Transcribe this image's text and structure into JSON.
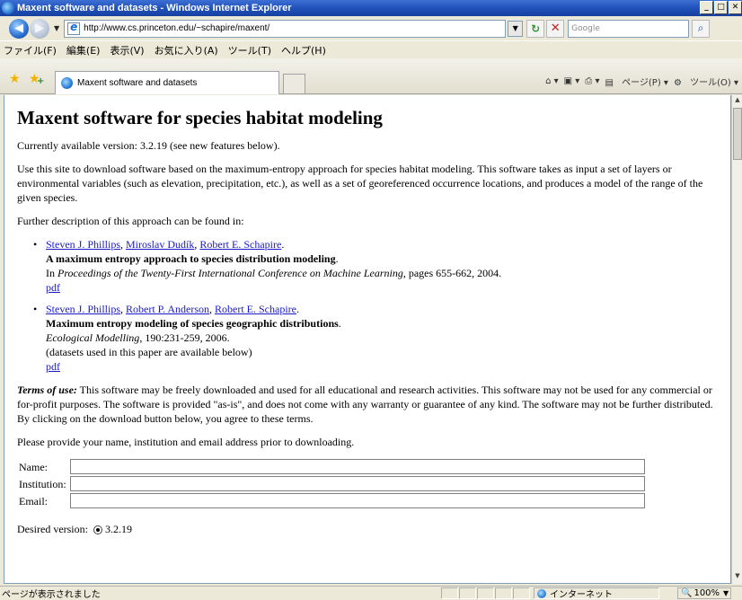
{
  "window": {
    "title": "Maxent software and datasets - Windows Internet Explorer",
    "min_label": "_",
    "max_label": "□",
    "close_label": "✕"
  },
  "address_bar": {
    "url": "http://www.cs.princeton.edu/~schapire/maxent/",
    "search_placeholder": "Google",
    "back_icon": "◀",
    "forward_icon": "▶",
    "refresh_icon": "↻",
    "stop_icon": "✕",
    "search_icon": "⌕"
  },
  "menu": {
    "items": [
      "ファイル(F)",
      "編集(E)",
      "表示(V)",
      "お気に入り(A)",
      "ツール(T)",
      "ヘルプ(H)"
    ]
  },
  "tabs": {
    "active_label": "Maxent software and datasets"
  },
  "command_bar": {
    "page_label": "ページ(P)",
    "tools_label": "ツール(O)"
  },
  "content": {
    "heading": "Maxent software for species habitat modeling",
    "version_text": "Currently available version: 3.2.19 (see new features below).",
    "intro": "Use this site to download software based on the maximum-entropy approach for species habitat modeling.  This software takes as input a set of layers or environmental variables (such as elevation, precipitation, etc.), as well as a set of georeferenced occurrence locations, and produces a model of the range of the given species.",
    "further": "Further description of this approach can be found in:",
    "refs": [
      {
        "authors": [
          "Steven J. Phillips",
          "Miroslav Dudík",
          "Robert E. Schapire"
        ],
        "title": "A maximum entropy approach to species distribution modeling",
        "venue_prefix": "In ",
        "venue": "Proceedings of the Twenty-First International Conference on Machine Learning",
        "venue_suffix": ", pages 655-662, 2004.",
        "note": "",
        "pdf": "pdf"
      },
      {
        "authors": [
          "Steven J. Phillips",
          "Robert P. Anderson",
          "Robert E. Schapire"
        ],
        "title": "Maximum entropy modeling of species geographic distributions",
        "venue_prefix": "",
        "venue": "Ecological Modelling",
        "venue_suffix": ", 190:231-259, 2006.",
        "note": "(datasets used in this paper are available below)",
        "pdf": "pdf"
      }
    ],
    "terms_label": "Terms of use:",
    "terms_text": "  This software may be freely downloaded and used for all educational and research activities.  This software may not be used for any commercial or for-profit purposes.  The software is provided \"as-is\", and does not come with any warranty or guarantee of any kind.  The software may not be further distributed.  By clicking on the download button below, you agree to these terms.",
    "provide_text": "Please provide your name, institution and email address prior to downloading.",
    "form": {
      "name_label": "Name:",
      "institution_label": "Institution:",
      "email_label": "Email:",
      "name_value": "",
      "institution_value": "",
      "email_value": ""
    },
    "desired_version_label": "Desired version:",
    "desired_version_value": "3.2.19"
  },
  "status_bar": {
    "text": "ページが表示されました",
    "zone": "インターネット",
    "zoom": "100%"
  },
  "colors": {
    "link": "#1a1ac8",
    "titlebar": "#1f4fb8"
  }
}
